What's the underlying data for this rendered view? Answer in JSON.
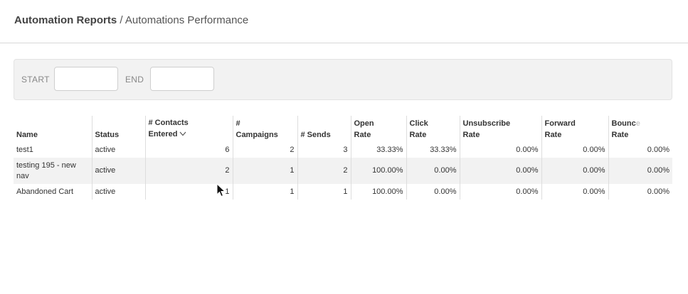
{
  "breadcrumb": {
    "parent": "Automation Reports",
    "separator": " / ",
    "current": "Automations Performance"
  },
  "filters": {
    "start_label": "START",
    "start_value": "",
    "end_label": "END",
    "end_value": ""
  },
  "table": {
    "headers": {
      "name": "Name",
      "status": "Status",
      "contacts_line1": "# Contacts",
      "contacts_line2": "Entered",
      "sort_icon": "chevron-down-icon",
      "campaigns_line1": "#",
      "campaigns_line2": "Campaigns",
      "sends": "# Sends",
      "open_line1": "Open",
      "open_line2": "Rate",
      "click_line1": "Click",
      "click_line2": "Rate",
      "unsub_line1": "Unsubscribe",
      "unsub_line2": "Rate",
      "forward_line1": "Forward",
      "forward_line2": "Rate",
      "bounce_line1": "Bounc",
      "bounce_line1_fade": "e",
      "bounce_line2": "Rate"
    },
    "rows": [
      {
        "name": "test1",
        "status": "active",
        "contacts": "6",
        "campaigns": "2",
        "sends": "3",
        "open_rate": "33.33%",
        "click_rate": "33.33%",
        "unsub_rate": "0.00%",
        "forward_rate": "0.00%",
        "bounce_rate": "0.00%"
      },
      {
        "name": "testing 195 - new nav",
        "status": "active",
        "contacts": "2",
        "campaigns": "1",
        "sends": "2",
        "open_rate": "100.00%",
        "click_rate": "0.00%",
        "unsub_rate": "0.00%",
        "forward_rate": "0.00%",
        "bounce_rate": "0.00%"
      },
      {
        "name": "Abandoned Cart",
        "status": "active",
        "contacts": "1",
        "campaigns": "1",
        "sends": "1",
        "open_rate": "100.00%",
        "click_rate": "0.00%",
        "unsub_rate": "0.00%",
        "forward_rate": "0.00%",
        "bounce_rate": "0.00%"
      }
    ]
  }
}
